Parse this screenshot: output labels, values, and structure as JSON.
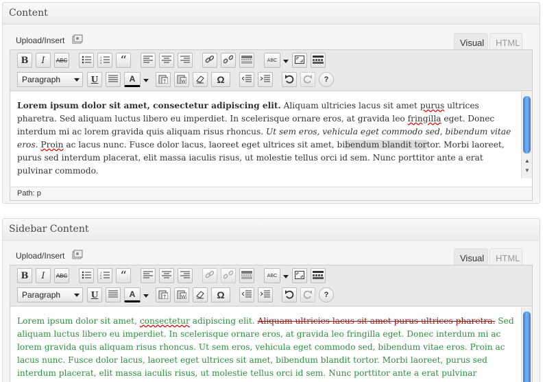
{
  "boxes": [
    {
      "title": "Content",
      "upload_label": "Upload/Insert",
      "tabs": {
        "visual": "Visual",
        "html": "HTML"
      },
      "format_select": "Paragraph",
      "content": {
        "bold": "Lorem ipsum dolor sit amet, consectetur adipiscing elit.",
        "p1": " Aliquam ultricies lacus sit amet ",
        "spell1": "purus",
        "p2": " ultrices pharetra. Sed aliquam luctus libero eu imperdiet. In scelerisque ornare eros, at gravida leo ",
        "spell2": "fringilla",
        "p3": " eget. Donec interdum mi ac lorem gravida quis aliquam risus rhoncus. ",
        "italic": "Ut sem eros, vehicula eget commodo sed, bibendum vitae eros",
        "p4": ". ",
        "spell3": "Proin",
        "p5": " ac lacus nunc. Fusce dolor lacus, laoreet eget ultrices sit amet, bi",
        "hl": "bendum blandit tor",
        "p6": "tor. Morbi laoreet, purus sed interdum placerat, elit massa iaculis risus, ut molestie tellus orci id sem. Nunc porttitor ante a erat pulvinar commodo."
      },
      "path": "Path: p"
    },
    {
      "title": "Sidebar Content",
      "upload_label": "Upload/Insert",
      "tabs": {
        "visual": "Visual",
        "html": "HTML"
      },
      "format_select": "Paragraph",
      "content": {
        "p1": "Lorem ipsum dolor sit amet, ",
        "spell1": "consectetur",
        "p2": " adipiscing elit. ",
        "strike": "Aliquam ultricies lacus sit amet purus ultrices pharetra.",
        "p3": " Sed aliquam luctus libero eu imperdiet. In scelerisque ornare eros, at gravida leo fringilla eget. Donec interdum mi ac lorem gravida quis aliquam risus rhoncus. Ut sem eros, vehicula eget commodo sed, bibendum vitae eros. Proin ac lacus nunc. Fusce dolor lacus, laoreet eget ultrices sit amet, bibendum blandit tortor. Morbi laoreet, purus sed interdum placerat, elit massa iaculis risus, ut molestie tellus orci id sem. Nunc porttitor ante a erat pulvinar commodo."
      }
    }
  ],
  "toolbar": {
    "bold": "B",
    "italic": "I",
    "strikethrough": "ABC",
    "blockquote": "“",
    "underline": "U",
    "text_color": "A",
    "special_char": "Ω",
    "help": "?",
    "spellcheck": "ABC"
  },
  "colors": {
    "accent": "#2e8f3e",
    "scroll": "#4a86d8"
  }
}
